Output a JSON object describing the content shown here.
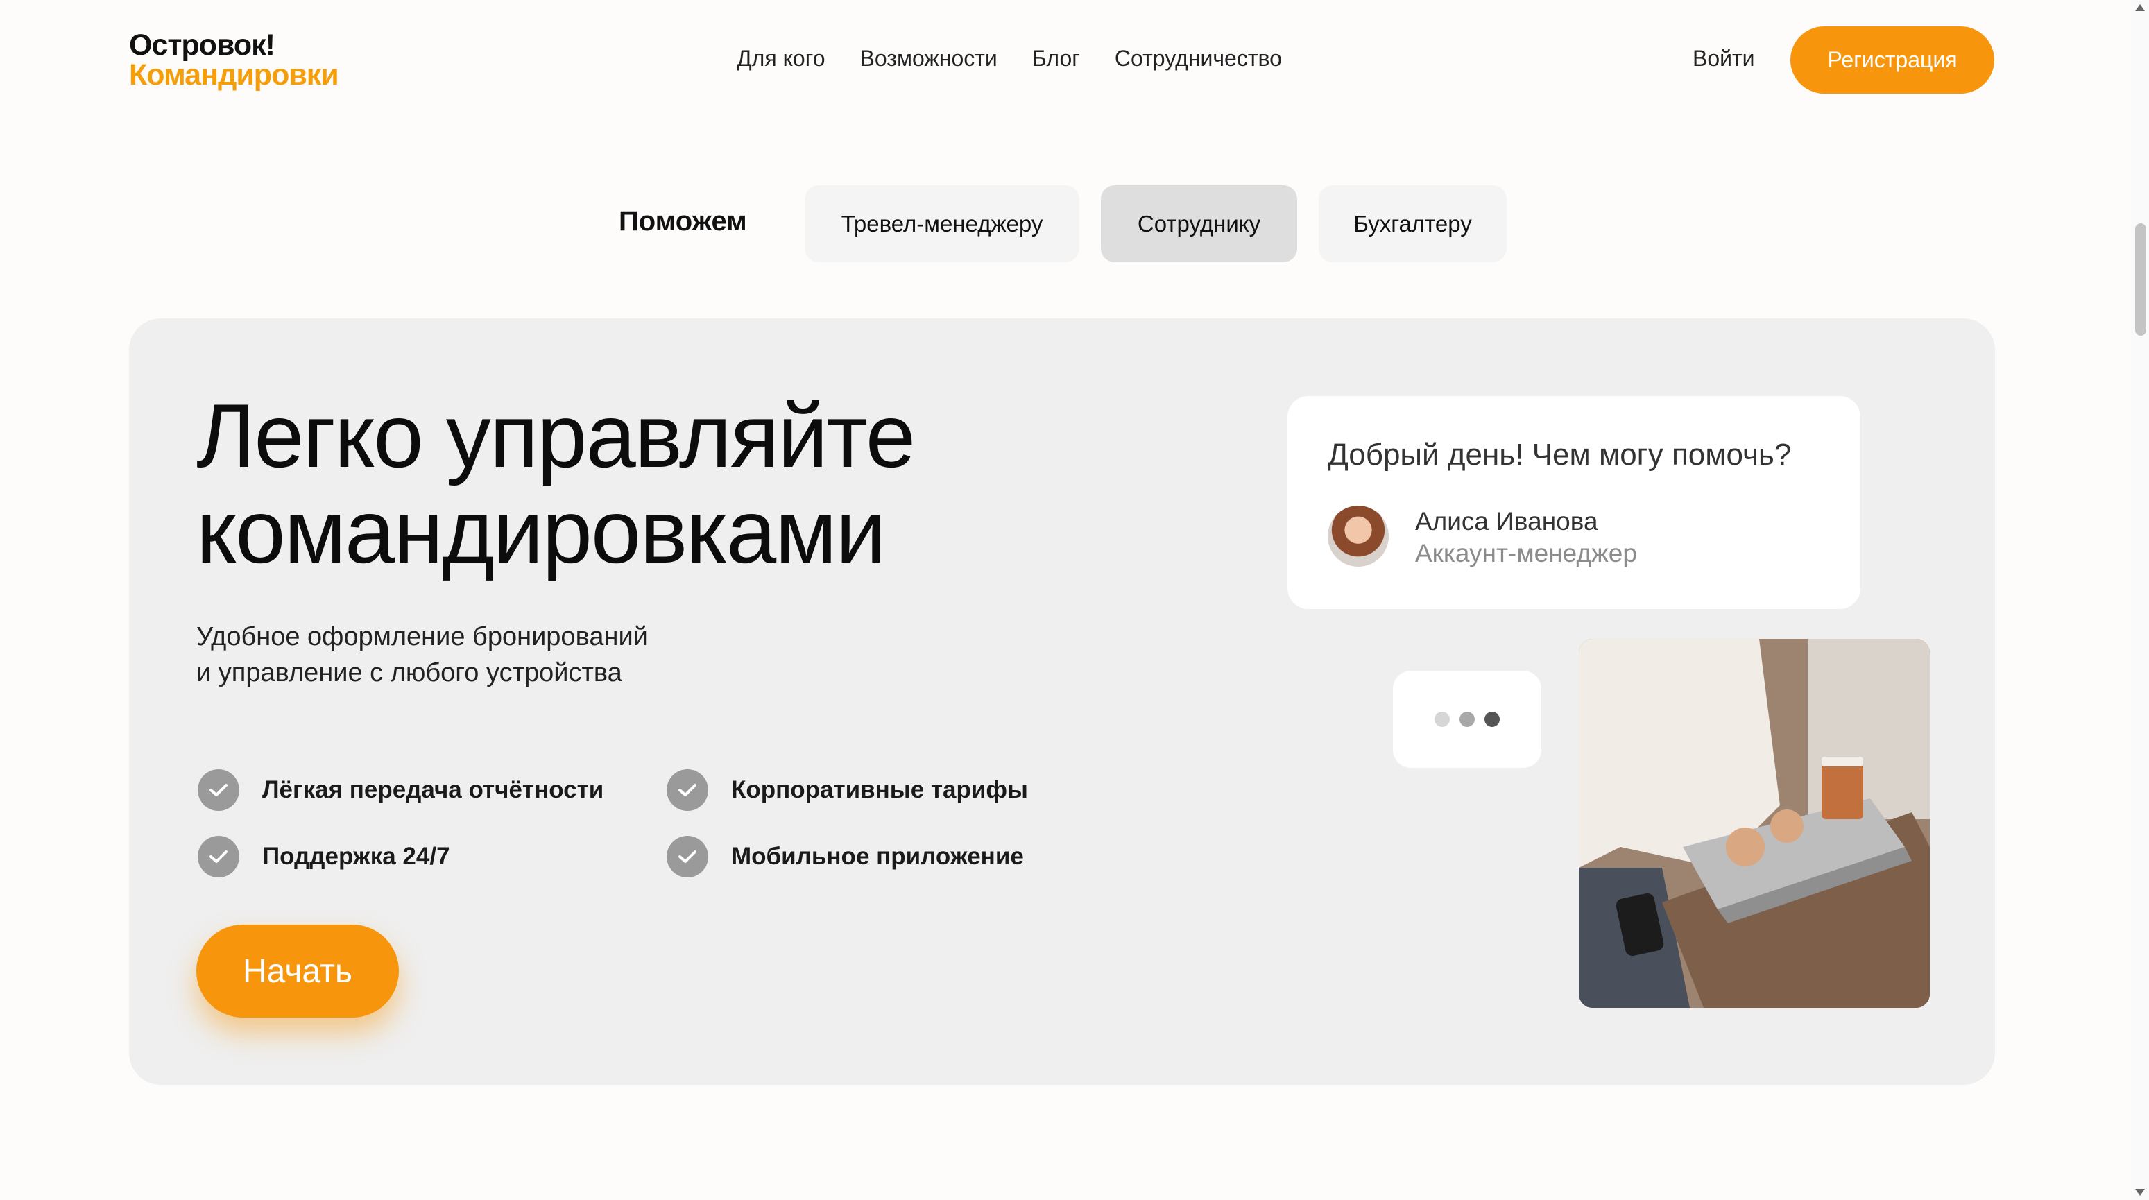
{
  "header": {
    "logo_line1": "Островок!",
    "logo_line2": "Командировки",
    "nav": [
      "Для кого",
      "Возможности",
      "Блог",
      "Сотрудничество"
    ],
    "login": "Войти",
    "register": "Регистрация"
  },
  "tabs": {
    "label": "Поможем",
    "items": [
      "Тревел-менеджеру",
      "Сотруднику",
      "Бухгалтеру"
    ],
    "active": "Сотруднику"
  },
  "hero": {
    "title_line1": "Легко управляйте",
    "title_line2": "командировками",
    "subtitle_line1": "Удобное оформление бронирований",
    "subtitle_line2": "и управление с любого устройства",
    "features": [
      "Лёгкая передача отчётности",
      "Корпоративные тарифы",
      "Поддержка 24/7",
      "Мобильное приложение"
    ],
    "cta": "Начать"
  },
  "chat": {
    "greeting": "Добрый день! Чем могу помочь?",
    "agent_name": "Алиса Иванова",
    "agent_role": "Аккаунт-менеджер"
  },
  "colors": {
    "accent": "#f7960d",
    "logo_orange": "#f59e0b",
    "card_bg": "#efefef",
    "tab_active": "#dedede",
    "check_bg": "#9a9a9a"
  },
  "icons": {
    "feature": "check-circle-icon",
    "typing": "typing-dots-icon"
  }
}
